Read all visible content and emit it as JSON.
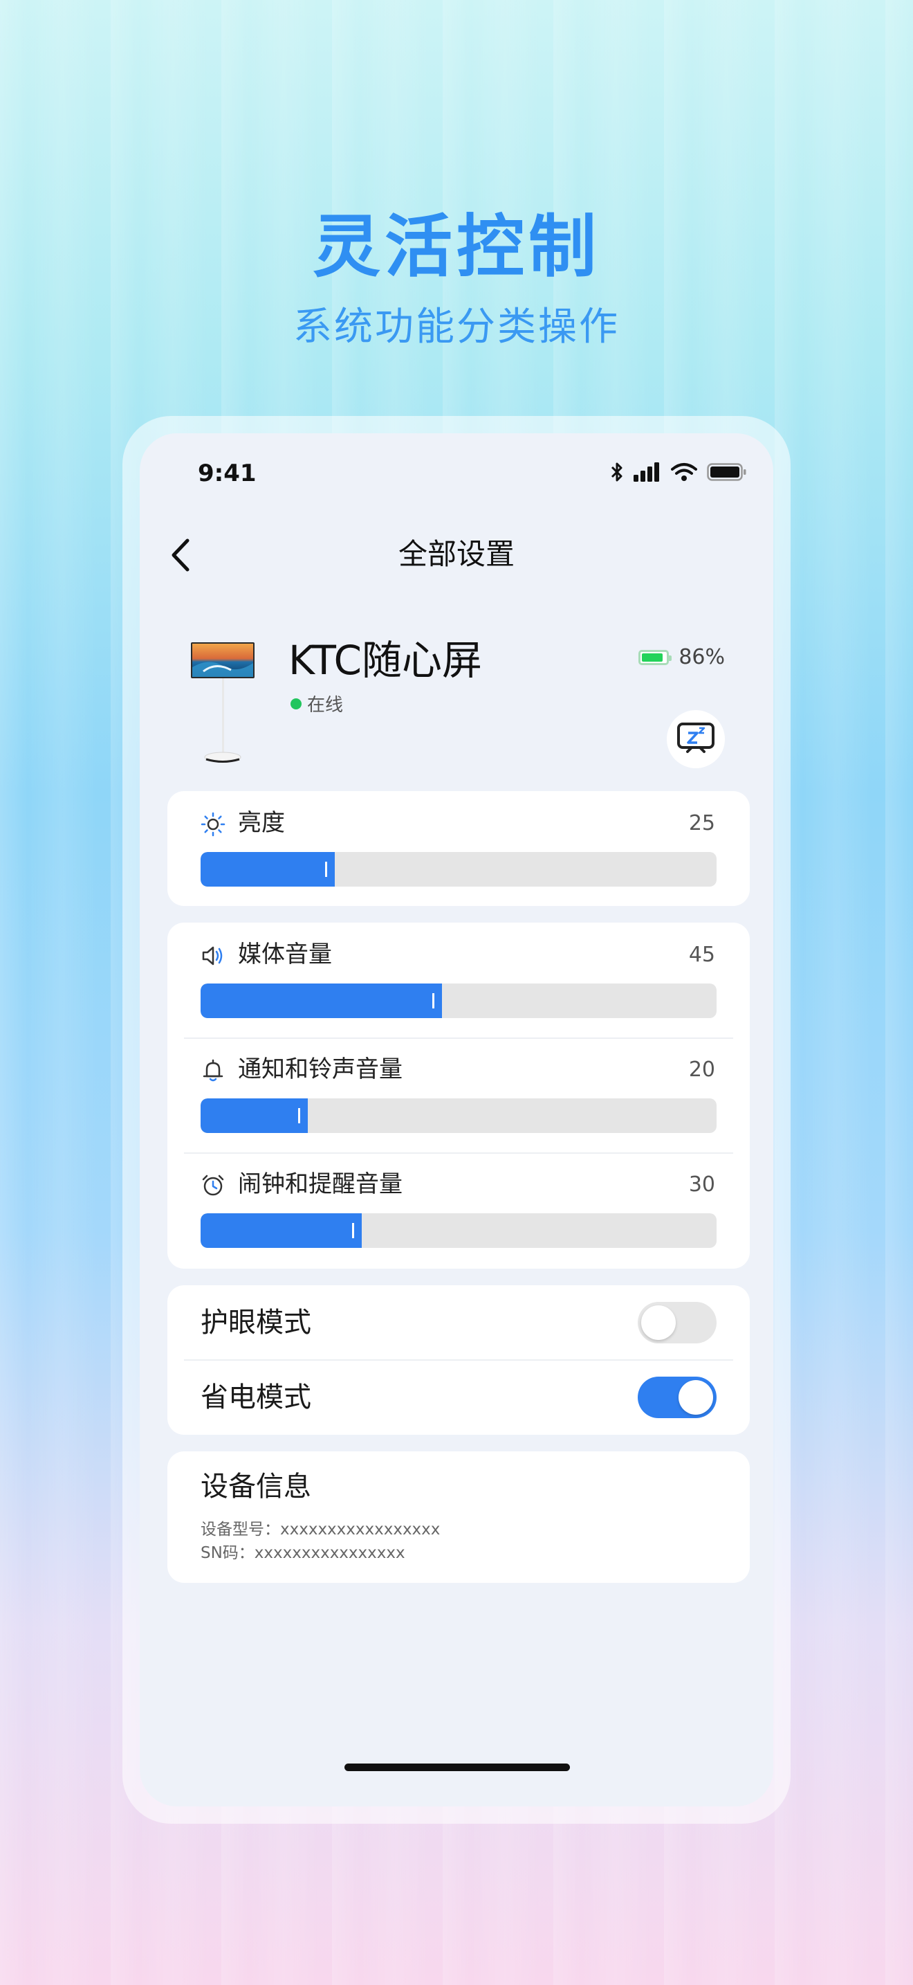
{
  "hero": {
    "title": "灵活控制",
    "subtitle": "系统功能分类操作"
  },
  "status_bar": {
    "time": "9:41"
  },
  "nav": {
    "title": "全部设置"
  },
  "device": {
    "name": "KTC随心屏",
    "status": "在线",
    "battery": "86%",
    "battery_level": 0.86
  },
  "sliders": {
    "brightness": {
      "label": "亮度",
      "value": "25",
      "level": 0.25,
      "icon": "sun-icon"
    },
    "media": {
      "label": "媒体音量",
      "value": "45",
      "level": 0.45,
      "icon": "speaker-icon"
    },
    "notification": {
      "label": "通知和铃声音量",
      "value": "20",
      "level": 0.2,
      "icon": "bell-icon"
    },
    "alarm": {
      "label": "闹钟和提醒音量",
      "value": "30",
      "level": 0.3,
      "icon": "alarm-clock-icon"
    }
  },
  "toggles": {
    "eye_care": {
      "label": "护眼模式",
      "on": false
    },
    "power_save": {
      "label": "省电模式",
      "on": true
    }
  },
  "info": {
    "title": "设备信息",
    "model_line": "设备型号：xxxxxxxxxxxxxxxxx",
    "sn_line": "SN码：xxxxxxxxxxxxxxxx"
  },
  "colors": {
    "accent": "#2f7ff0",
    "hero": "#2f8ff2",
    "online": "#22c55e",
    "toggle_off": "#e6e6e6"
  }
}
